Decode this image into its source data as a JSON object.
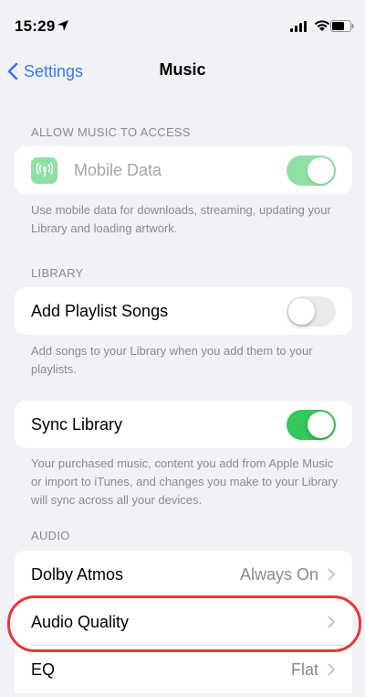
{
  "status": {
    "time": "15:29"
  },
  "nav": {
    "back_label": "Settings",
    "title": "Music"
  },
  "sections": {
    "access": {
      "header": "ALLOW MUSIC TO ACCESS",
      "mobile_data_label": "Mobile Data",
      "mobile_data_on": true,
      "footer": "Use mobile data for downloads, streaming, updating your Library and loading artwork."
    },
    "library": {
      "header": "LIBRARY",
      "add_playlist_label": "Add Playlist Songs",
      "add_playlist_on": false,
      "add_playlist_footer": "Add songs to your Library when you add them to your playlists.",
      "sync_label": "Sync Library",
      "sync_on": true,
      "sync_footer": "Your purchased music, content you add from Apple Music or import to iTunes, and changes you make to your Library will sync across all your devices."
    },
    "audio": {
      "header": "AUDIO",
      "items": [
        {
          "label": "Dolby Atmos",
          "value": "Always On"
        },
        {
          "label": "Audio Quality",
          "value": ""
        },
        {
          "label": "EQ",
          "value": "Flat"
        }
      ]
    }
  },
  "colors": {
    "accent": "#3478f6",
    "toggle_on": "#34c759",
    "highlight": "#e53935"
  }
}
